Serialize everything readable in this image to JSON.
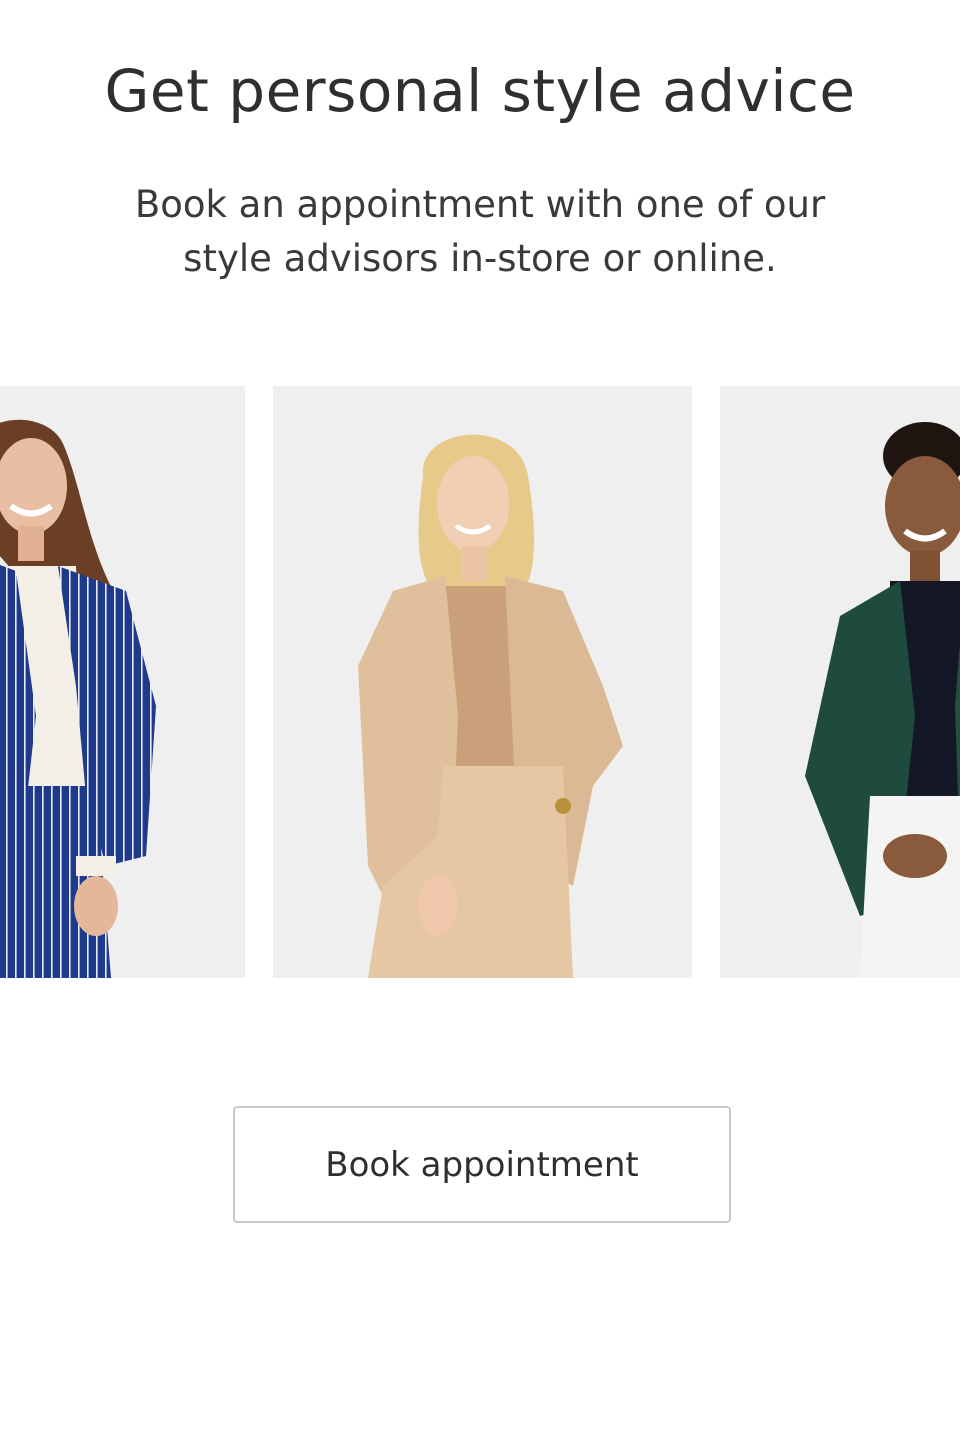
{
  "header": {
    "title": "Get personal style advice",
    "subtitle": "Book an appointment with one of our style advisors in-store or online."
  },
  "carousel": {
    "cards": [
      {
        "icon": "advisor-photo-navy-pinstripe-suit"
      },
      {
        "icon": "advisor-photo-beige-suit"
      },
      {
        "icon": "advisor-photo-green-blazer"
      }
    ]
  },
  "cta": {
    "label": "Book appointment"
  },
  "colors": {
    "background": "#ffffff",
    "card_background": "#efefef",
    "text": "#333333",
    "button_border": "#c8c8c8"
  }
}
